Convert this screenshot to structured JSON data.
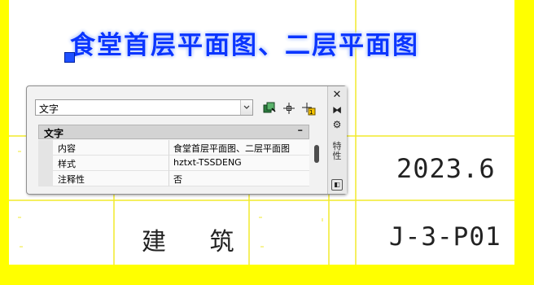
{
  "drawing": {
    "title": "食堂首层平面图、二层平面图",
    "date": "2023.6",
    "discipline": "建  筑",
    "drawing_number": "J-3-P01"
  },
  "colors": {
    "frame_yellow": "#ffff00",
    "grid_yellow": "#f2ea2c",
    "title_blue": "#0a35ff",
    "grip_blue": "#1e50ff"
  },
  "palette": {
    "selector_value": "文字",
    "toolbar": {
      "quick_select_icon": "quick-select-icon",
      "select_objects_icon": "crosshair-icon",
      "toggle_pickadd_icon": "pickadd-icon"
    },
    "category": {
      "label": "文字",
      "toggle": "–"
    },
    "properties": [
      {
        "name": "内容",
        "value": "食堂首层平面图、二层平面图"
      },
      {
        "name": "样式",
        "value": "hztxt-TSSDENG"
      },
      {
        "name": "注释性",
        "value": "否"
      }
    ],
    "titlebar": {
      "close": "✕",
      "autohide": "⧓",
      "settings": "⚙",
      "title_chars": [
        "特",
        "性"
      ],
      "bottom_icon": "◧"
    }
  }
}
